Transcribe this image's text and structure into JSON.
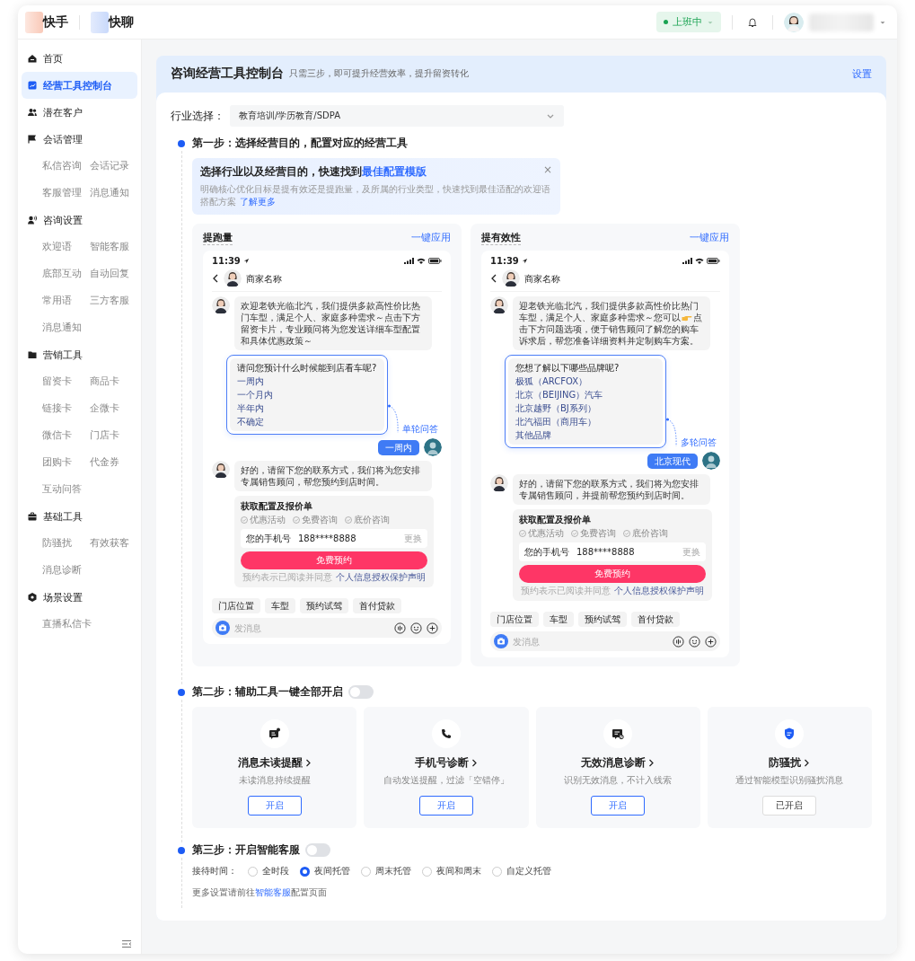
{
  "top_bar": {
    "apps": [
      {
        "name": "快手"
      },
      {
        "name": "快聊"
      }
    ],
    "status": "上班中"
  },
  "sidebar": {
    "items": [
      {
        "label": "首页",
        "selected": false
      },
      {
        "label": "经营工具控制台",
        "selected": true
      },
      {
        "label": "潜在客户",
        "selected": false
      },
      {
        "label": "会话管理",
        "selected": false,
        "children": [
          {
            "label": "私信咨询",
            "selected": false
          },
          {
            "label": "会话记录",
            "selected": false
          },
          {
            "label": "客服管理",
            "selected": false
          },
          {
            "label": "消息通知",
            "selected": false
          }
        ]
      },
      {
        "label": "咨询设置",
        "selected": false,
        "children": [
          {
            "label": "欢迎语",
            "selected": false
          },
          {
            "label": "智能客服",
            "selected": false
          },
          {
            "label": "底部互动",
            "selected": false
          },
          {
            "label": "自动回复",
            "selected": false
          },
          {
            "label": "常用语",
            "selected": false
          },
          {
            "label": "三方客服",
            "selected": false
          },
          {
            "label": "消息通知",
            "selected": false
          }
        ]
      },
      {
        "label": "营销工具",
        "selected": false,
        "children": [
          {
            "label": "留资卡",
            "selected": false
          },
          {
            "label": "商品卡",
            "selected": false
          },
          {
            "label": "链接卡",
            "selected": false
          },
          {
            "label": "企微卡",
            "selected": false
          },
          {
            "label": "微信卡",
            "selected": false
          },
          {
            "label": "门店卡",
            "selected": false
          },
          {
            "label": "团购卡",
            "selected": false
          },
          {
            "label": "代金券",
            "selected": false
          },
          {
            "label": "互动问答",
            "selected": false
          }
        ]
      },
      {
        "label": "基础工具",
        "selected": false,
        "children": [
          {
            "label": "防骚扰",
            "selected": false
          },
          {
            "label": "有效获客",
            "selected": false
          },
          {
            "label": "消息诊断",
            "selected": false
          }
        ]
      },
      {
        "label": "场景设置",
        "selected": false,
        "children": [
          {
            "label": "直播私信卡",
            "selected": false
          }
        ]
      }
    ]
  },
  "header": {
    "title": "咨询经营工具控制台",
    "subtitle": "只需三步，即可提升经营效率，提升留资转化",
    "settings": "设置"
  },
  "industry": {
    "label": "行业选择：",
    "value": "教育培训/学历教育/SDPA"
  },
  "step1": {
    "title": "第一步：选择经营目的，配置对应的经营工具",
    "banner": {
      "title": "选择行业以及经营目的，快速找到",
      "highlight": "最佳配置模版",
      "description": "明确核心优化目标是提有效还是提跑量，及所属的行业类型，快速找到最佳适配的欢迎语搭配方案",
      "link": "了解更多",
      "close": "×"
    },
    "templates": [
      {
        "title": "提跑量",
        "apply": "一键应用",
        "phone": {
          "time": "11:39",
          "contact": "商家名称",
          "greeting": "欢迎老铁光临北汽，我们提供多款高性价比热门车型，满足个人、家庭多种需求～点击下方留资卡片，专业顾问将为您发送详细车型配置和具体优惠政策～",
          "question": "请问您预计什么时候能到店看车呢?",
          "options": [
            "一周内",
            "一个月内",
            "半年内",
            "不确定"
          ],
          "annotation": "单轮问答",
          "reply": "一周内",
          "followup": "好的，请留下您的联系方式，我们将为您安排专属销售顾问，帮您预约到店时间。",
          "form": {
            "title": "获取配置及报价单",
            "perks": [
              "优惠活动",
              "免费咨询",
              "底价咨询"
            ],
            "phone_label": "您的手机号",
            "phone_value": "188****8888",
            "change": "更换",
            "button": "免费预约",
            "note": "预约表示已阅读并同意",
            "note_link": "个人信息授权保护声明"
          },
          "chips": [
            "门店位置",
            "车型",
            "预约试驾",
            "首付贷款"
          ],
          "input_placeholder": "发消息"
        }
      },
      {
        "title": "提有效性",
        "apply": "一键应用",
        "phone": {
          "time": "11:39",
          "contact": "商家名称",
          "greeting": "迎老铁光临北汽，我们提供多款高性价比热门车型，满足个人、家庭多种需求～您可以",
          "greeting_after_icon": "点击下方问题选项，便于销售顾问了解您的购车诉求后，帮您准备详细资料并定制购车方案。",
          "question": "您想了解以下哪些品牌呢?",
          "options": [
            "极狐（ARCFOX）",
            "北京（BEIJING）汽车",
            "北京越野（BJ系列）",
            "北汽福田（商用车）",
            "其他品牌"
          ],
          "annotation": "多轮问答",
          "reply": "北京现代",
          "followup": "好的，请留下您的联系方式，我们将为您安排专属销售顾问，并提前帮您预约到店时间。",
          "form": {
            "title": "获取配置及报价单",
            "perks": [
              "优惠活动",
              "免费咨询",
              "底价咨询"
            ],
            "phone_label": "您的手机号",
            "phone_value": "188****8888",
            "change": "更换",
            "button": "免费预约",
            "note": "预约表示已阅读并同意",
            "note_link": "个人信息授权保护声明"
          },
          "chips": [
            "门店位置",
            "车型",
            "预约试驾",
            "首付贷款"
          ],
          "input_placeholder": "发消息"
        }
      }
    ]
  },
  "step2": {
    "title": "第二步：辅助工具一键全部开启",
    "toggle_on": false,
    "tools": [
      {
        "title": "消息未读提醒",
        "description": "未读消息持续提醒",
        "button": "开启",
        "enabled": false
      },
      {
        "title": "手机号诊断",
        "description": "自动发送提醒，过滤「空错停」",
        "button": "开启",
        "enabled": false
      },
      {
        "title": "无效消息诊断",
        "description": "识别无效消息，不计入线索",
        "button": "开启",
        "enabled": false
      },
      {
        "title": "防骚扰",
        "description": "通过智能模型识别骚扰消息",
        "button": "已开启",
        "enabled": true
      }
    ]
  },
  "step3": {
    "title": "第三步：开启智能客服",
    "toggle_on": false,
    "schedule_label": "接待时间：",
    "options": [
      {
        "label": "全时段",
        "selected": false
      },
      {
        "label": "夜间托管",
        "selected": true
      },
      {
        "label": "周末托管",
        "selected": false
      },
      {
        "label": "夜间和周末",
        "selected": false
      },
      {
        "label": "自定义托管",
        "selected": false
      }
    ],
    "note": {
      "before": "更多设置请前往",
      "link": "智能客服",
      "after": "配置页面"
    }
  }
}
